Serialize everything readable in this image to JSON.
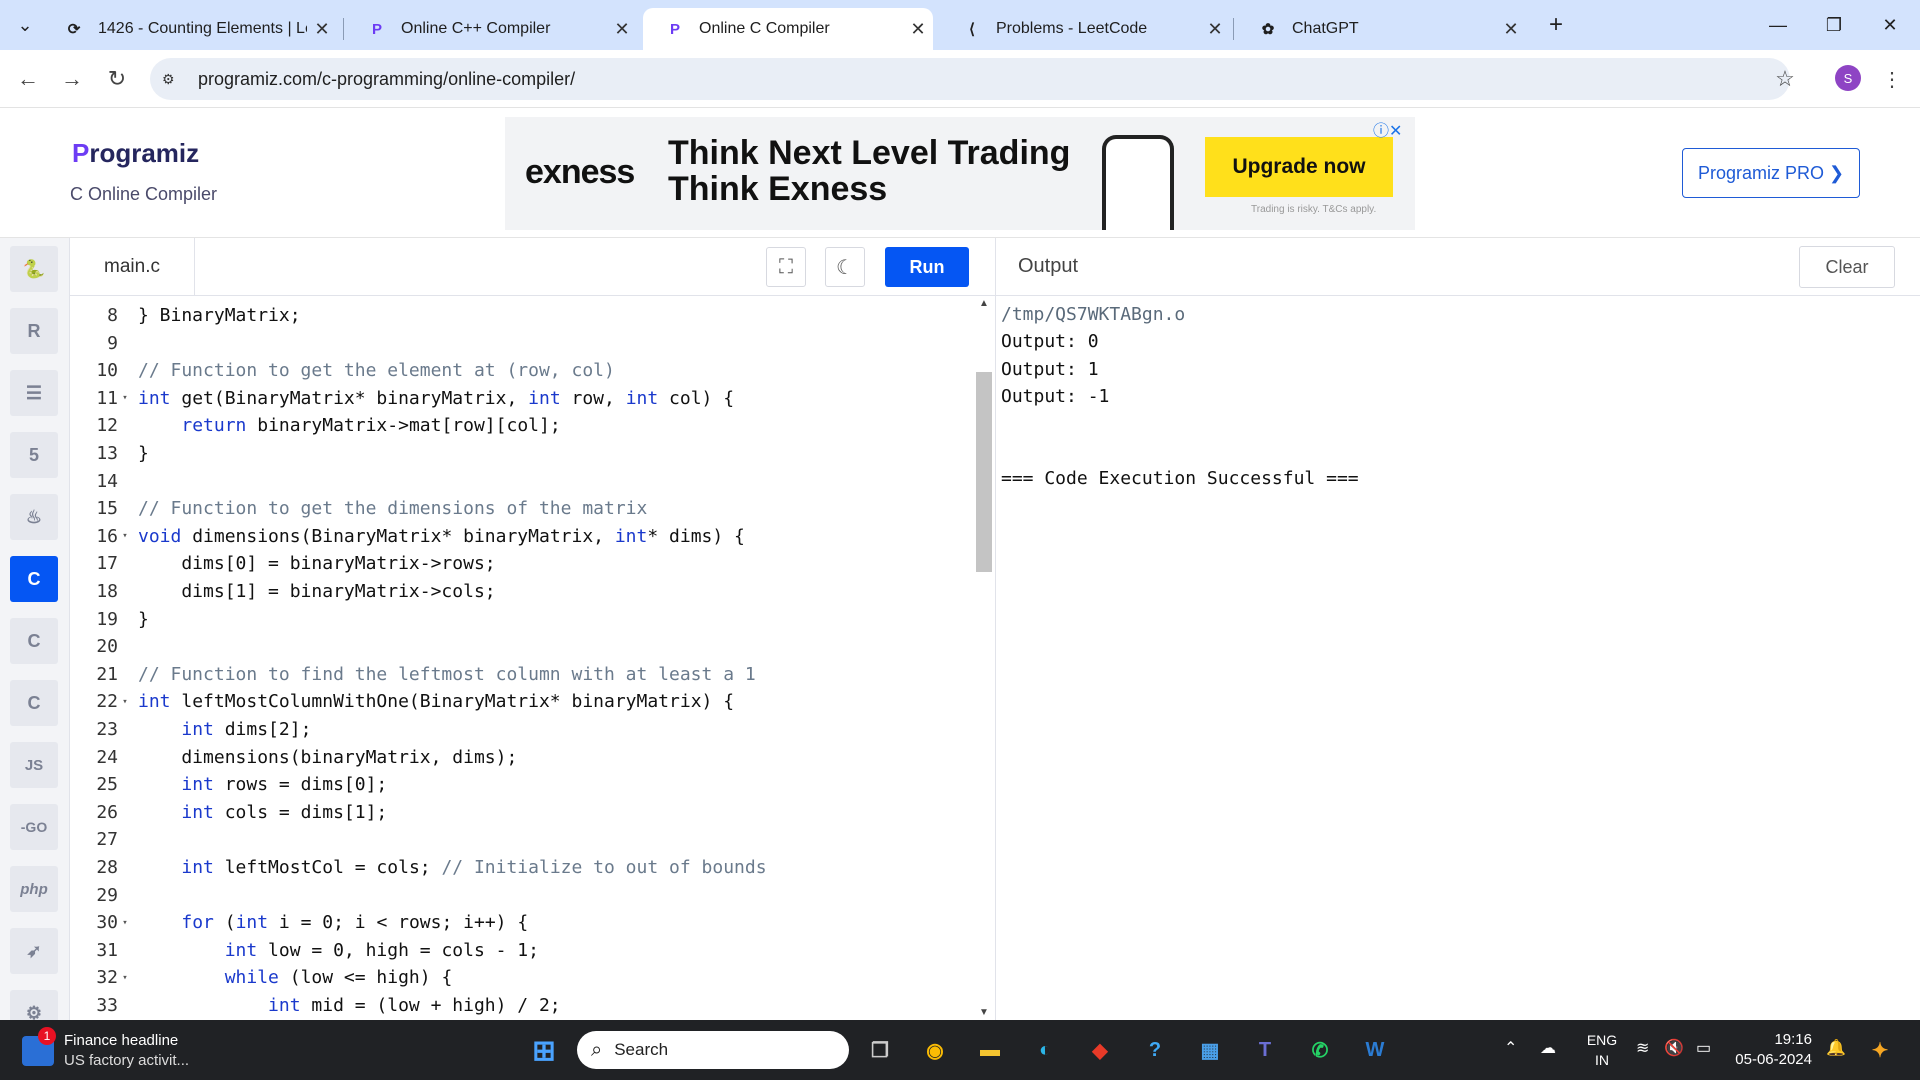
{
  "browser": {
    "tabs": [
      {
        "title": "1426 - Counting Elements | Lee",
        "icon": "leetcode-icon",
        "active": false
      },
      {
        "title": "Online C++ Compiler",
        "icon": "programiz-icon",
        "active": false
      },
      {
        "title": "Online C Compiler",
        "icon": "programiz-icon",
        "active": true
      },
      {
        "title": "Problems - LeetCode",
        "icon": "leetcode-icon",
        "active": false
      },
      {
        "title": "ChatGPT",
        "icon": "chatgpt-icon",
        "active": false
      }
    ],
    "url": "programiz.com/c-programming/online-compiler/",
    "profile_initial": "S"
  },
  "header": {
    "logo": "Programiz",
    "logo_first": "P",
    "logo_rest": "rogramiz",
    "subtitle": "C Online Compiler",
    "pro_button": "Programiz PRO ❯"
  },
  "ad": {
    "brand": "exness",
    "headline_line1": "Think Next Level Trading",
    "headline_line2": "Think Exness",
    "cta": "Upgrade now",
    "disclaimer": "Trading is risky. T&Cs apply."
  },
  "sidebar": {
    "languages": [
      "python",
      "r",
      "sql",
      "html",
      "java",
      "c",
      "c++",
      "c#",
      "javascript",
      "go",
      "php",
      "swift",
      "rust"
    ],
    "labels": {
      "javascript": "JS",
      "go": "-GO",
      "php": "php"
    },
    "active": "c"
  },
  "editor": {
    "filename": "main.c",
    "run_label": "Run",
    "lines": [
      {
        "n": "8",
        "fold": false,
        "text": "} BinaryMatrix;"
      },
      {
        "n": "9",
        "fold": false,
        "text": ""
      },
      {
        "n": "10",
        "fold": false,
        "text": "// Function to get the element at (row, col)"
      },
      {
        "n": "11",
        "fold": true,
        "text": "int get(BinaryMatrix* binaryMatrix, int row, int col) {"
      },
      {
        "n": "12",
        "fold": false,
        "text": "    return binaryMatrix->mat[row][col];"
      },
      {
        "n": "13",
        "fold": false,
        "text": "}"
      },
      {
        "n": "14",
        "fold": false,
        "text": ""
      },
      {
        "n": "15",
        "fold": false,
        "text": "// Function to get the dimensions of the matrix"
      },
      {
        "n": "16",
        "fold": true,
        "text": "void dimensions(BinaryMatrix* binaryMatrix, int* dims) {"
      },
      {
        "n": "17",
        "fold": false,
        "text": "    dims[0] = binaryMatrix->rows;"
      },
      {
        "n": "18",
        "fold": false,
        "text": "    dims[1] = binaryMatrix->cols;"
      },
      {
        "n": "19",
        "fold": false,
        "text": "}"
      },
      {
        "n": "20",
        "fold": false,
        "text": ""
      },
      {
        "n": "21",
        "fold": false,
        "text": "// Function to find the leftmost column with at least a 1"
      },
      {
        "n": "22",
        "fold": true,
        "text": "int leftMostColumnWithOne(BinaryMatrix* binaryMatrix) {"
      },
      {
        "n": "23",
        "fold": false,
        "text": "    int dims[2];"
      },
      {
        "n": "24",
        "fold": false,
        "text": "    dimensions(binaryMatrix, dims);"
      },
      {
        "n": "25",
        "fold": false,
        "text": "    int rows = dims[0];"
      },
      {
        "n": "26",
        "fold": false,
        "text": "    int cols = dims[1];"
      },
      {
        "n": "27",
        "fold": false,
        "text": ""
      },
      {
        "n": "28",
        "fold": false,
        "text": "    int leftMostCol = cols; // Initialize to out of bounds"
      },
      {
        "n": "29",
        "fold": false,
        "text": ""
      },
      {
        "n": "30",
        "fold": true,
        "text": "    for (int i = 0; i < rows; i++) {"
      },
      {
        "n": "31",
        "fold": false,
        "text": "        int low = 0, high = cols - 1;"
      },
      {
        "n": "32",
        "fold": true,
        "text": "        while (low <= high) {"
      },
      {
        "n": "33",
        "fold": false,
        "text": "            int mid = (low + high) / 2;"
      }
    ]
  },
  "output": {
    "label": "Output",
    "clear_label": "Clear",
    "lines": [
      "/tmp/QS7WKTABgn.o",
      "Output: 0",
      "Output: 1",
      "Output: -1",
      "",
      "",
      "=== Code Execution Successful ==="
    ]
  },
  "taskbar": {
    "news_title": "Finance headline",
    "news_text": "US factory activit...",
    "news_badge": "1",
    "search_placeholder": "Search",
    "lang_line1": "ENG",
    "lang_line2": "IN",
    "time": "19:16",
    "date": "05-06-2024"
  },
  "colors": {
    "accent": "#0556f3",
    "comment": "#6a7a8c",
    "keyword": "#1a39cc"
  }
}
